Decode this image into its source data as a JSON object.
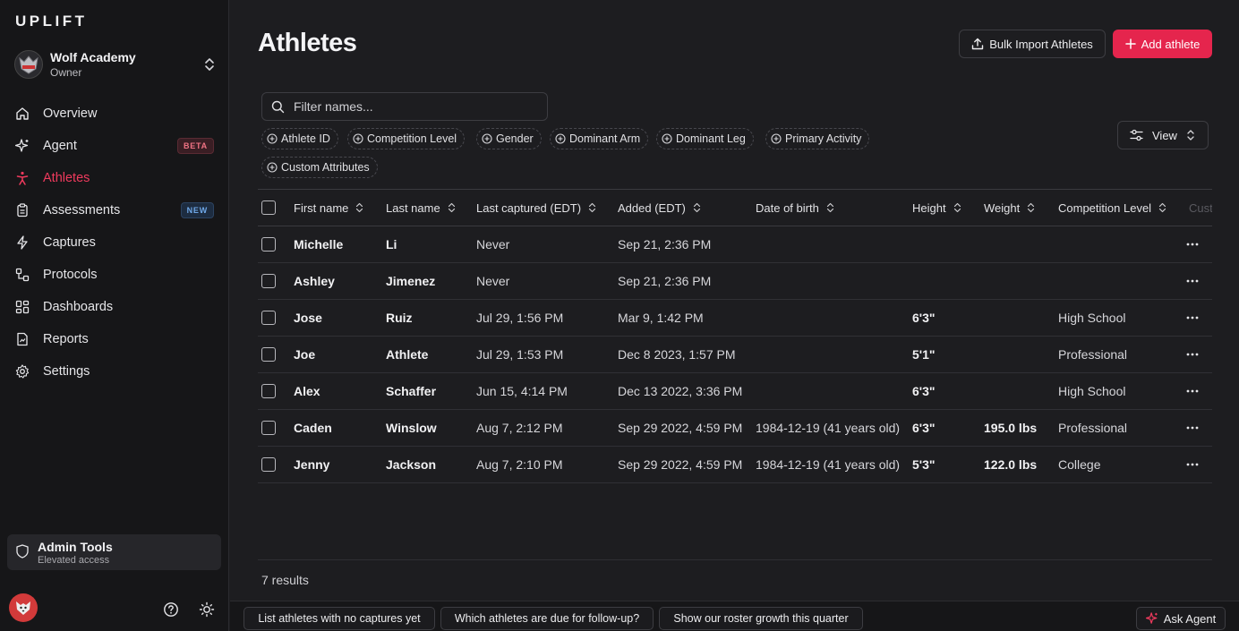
{
  "app": {
    "logo": "UPLIFT"
  },
  "org": {
    "name": "Wolf Academy",
    "role": "Owner",
    "avatar_icon": "wolf-logo-icon"
  },
  "nav": [
    {
      "id": "overview",
      "label": "Overview",
      "icon": "home-icon",
      "active": false,
      "badge": ""
    },
    {
      "id": "agent",
      "label": "Agent",
      "icon": "sparkle-icon",
      "active": false,
      "badge": "BETA"
    },
    {
      "id": "athletes",
      "label": "Athletes",
      "icon": "person-icon",
      "active": true,
      "badge": ""
    },
    {
      "id": "assessments",
      "label": "Assessments",
      "icon": "clipboard-icon",
      "active": false,
      "badge": "NEW"
    },
    {
      "id": "captures",
      "label": "Captures",
      "icon": "bolt-icon",
      "active": false,
      "badge": ""
    },
    {
      "id": "protocols",
      "label": "Protocols",
      "icon": "workflow-icon",
      "active": false,
      "badge": ""
    },
    {
      "id": "dashboards",
      "label": "Dashboards",
      "icon": "grid-icon",
      "active": false,
      "badge": ""
    },
    {
      "id": "reports",
      "label": "Reports",
      "icon": "report-icon",
      "active": false,
      "badge": ""
    },
    {
      "id": "settings",
      "label": "Settings",
      "icon": "gear-icon",
      "active": false,
      "badge": ""
    }
  ],
  "admin": {
    "title": "Admin Tools",
    "subtitle": "Elevated access"
  },
  "colors": {
    "accent": "#e5254d",
    "active_nav": "#ef3a5d",
    "background": "#1d1d20",
    "sidebar": "#161618"
  },
  "header": {
    "title": "Athletes",
    "import_label": "Bulk Import Athletes",
    "add_label": "Add athlete"
  },
  "search": {
    "placeholder": "Filter names...",
    "value": ""
  },
  "filters": [
    "Athlete ID",
    "Competition Level",
    "Gender",
    "Dominant Arm",
    "Dominant Leg",
    "Primary Activity",
    "Custom Attributes"
  ],
  "view_label": "View",
  "table": {
    "columns": [
      "First name",
      "Last name",
      "Last captured (EDT)",
      "Added (EDT)",
      "Date of birth",
      "Height",
      "Weight",
      "Competition Level",
      "Cust"
    ],
    "rows": [
      {
        "first": "Michelle",
        "last": "Li",
        "captured": "Never",
        "added": "Sep 21, 2:36 PM",
        "dob": "",
        "height": "",
        "weight": "",
        "level": ""
      },
      {
        "first": "Ashley",
        "last": "Jimenez",
        "captured": "Never",
        "added": "Sep 21, 2:36 PM",
        "dob": "",
        "height": "",
        "weight": "",
        "level": ""
      },
      {
        "first": "Jose",
        "last": "Ruiz",
        "captured": "Jul 29, 1:56 PM",
        "added": "Mar 9, 1:42 PM",
        "dob": "",
        "height": "6'3\"",
        "weight": "",
        "level": "High School"
      },
      {
        "first": "Joe",
        "last": "Athlete",
        "captured": "Jul 29, 1:53 PM",
        "added": "Dec 8 2023, 1:57 PM",
        "dob": "",
        "height": "5'1\"",
        "weight": "",
        "level": "Professional"
      },
      {
        "first": "Alex",
        "last": "Schaffer",
        "captured": "Jun 15, 4:14 PM",
        "added": "Dec 13 2022, 3:36 PM",
        "dob": "",
        "height": "6'3\"",
        "weight": "",
        "level": "High School"
      },
      {
        "first": "Caden",
        "last": "Winslow",
        "captured": "Aug 7, 2:12 PM",
        "added": "Sep 29 2022, 4:59 PM",
        "dob": "1984-12-19 (41 years old)",
        "height": "6'3\"",
        "weight": "195.0 lbs",
        "level": "Professional"
      },
      {
        "first": "Jenny",
        "last": "Jackson",
        "captured": "Aug 7, 2:10 PM",
        "added": "Sep 29 2022, 4:59 PM",
        "dob": "1984-12-19 (41 years old)",
        "height": "5'3\"",
        "weight": "122.0 lbs",
        "level": "College"
      }
    ]
  },
  "results_text": "7 results",
  "suggestions": [
    "List athletes with no captures yet",
    "Which athletes are due for follow-up?",
    "Show our roster growth this quarter"
  ],
  "ask_label": "Ask Agent"
}
